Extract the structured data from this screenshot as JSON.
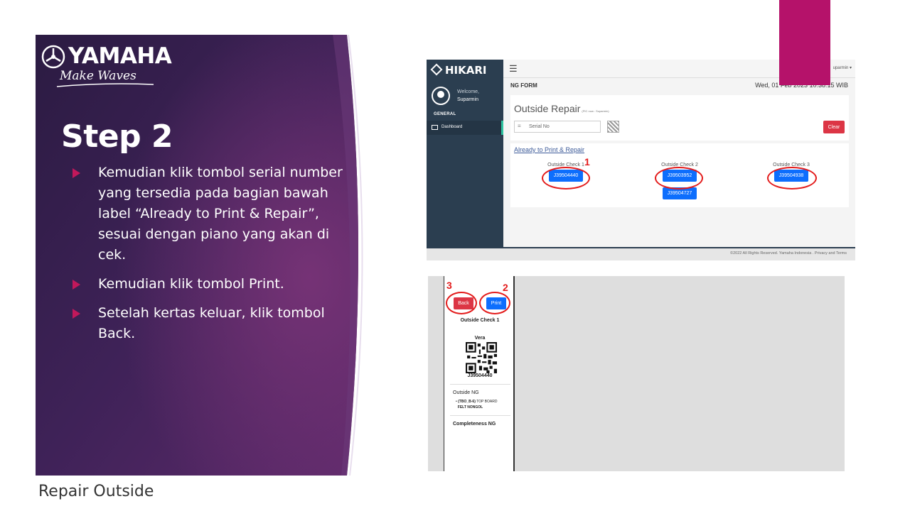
{
  "slide": {
    "brand": "YAMAHA",
    "tagline": "Make Waves",
    "step_title": "Step 2",
    "bullets": [
      "Kemudian klik tombol serial number yang tersedia pada bagian bawah label “Already to Print & Repair”, sesuai dengan piano yang akan di cek.",
      "Kemudian klik tombol Print.",
      "Setelah kertas keluar, klik tombol Back."
    ],
    "footer_label": "Repair Outside",
    "colors": {
      "panel_dark": "#2a1a40",
      "panel_purple": "#5a2a6a",
      "accent": "#b5126a",
      "bullet": "#c2185b",
      "annotation_red": "#e31b1b"
    }
  },
  "app": {
    "logo": "HIKARI",
    "welcome": "Welcome,",
    "user": "Suparmin",
    "user_menu": "uparmin",
    "section_label": "GENERAL",
    "nav_dashboard": "Dashboard",
    "page_header": "NG FORM",
    "datetime": "Wed, 01 Feb 2023 10:38:15 WIB",
    "form_title": "Outside Repair",
    "form_subtitle": "(PIC now : Suparmin)",
    "serial_placeholder": "Serial No",
    "clear_button": "Clear",
    "ready_link": "Already to Print & Repair",
    "columns": [
      {
        "header": "Outside Check 1",
        "serials": [
          "J39504440"
        ]
      },
      {
        "header": "Outside Check 2",
        "serials": [
          "J39503952",
          "J39504727"
        ]
      },
      {
        "header": "Outside Check 3",
        "serials": [
          "J39504938"
        ]
      }
    ],
    "footer": "©2022 All Rights Reserved. Yamaha Indonesia . Privacy and Terms",
    "icons": [
      "hikari-logo-icon",
      "menu-icon",
      "avatar-icon",
      "monitor-icon",
      "list-icon",
      "qr-scan-icon"
    ]
  },
  "print_view": {
    "back_button": "Back",
    "print_button": "Print",
    "check_title": "Outside Check 1",
    "model": "Vera",
    "serial": "J39504440",
    "outside_ng_label": "Outside NG",
    "ng_code": "(TBO_B-6)",
    "ng_part": "TOP BOARD",
    "ng_defect": "FELT NONGOL",
    "completeness_label": "Completeness NG"
  },
  "annotations": {
    "n1": "1",
    "n2": "2",
    "n3": "3"
  }
}
